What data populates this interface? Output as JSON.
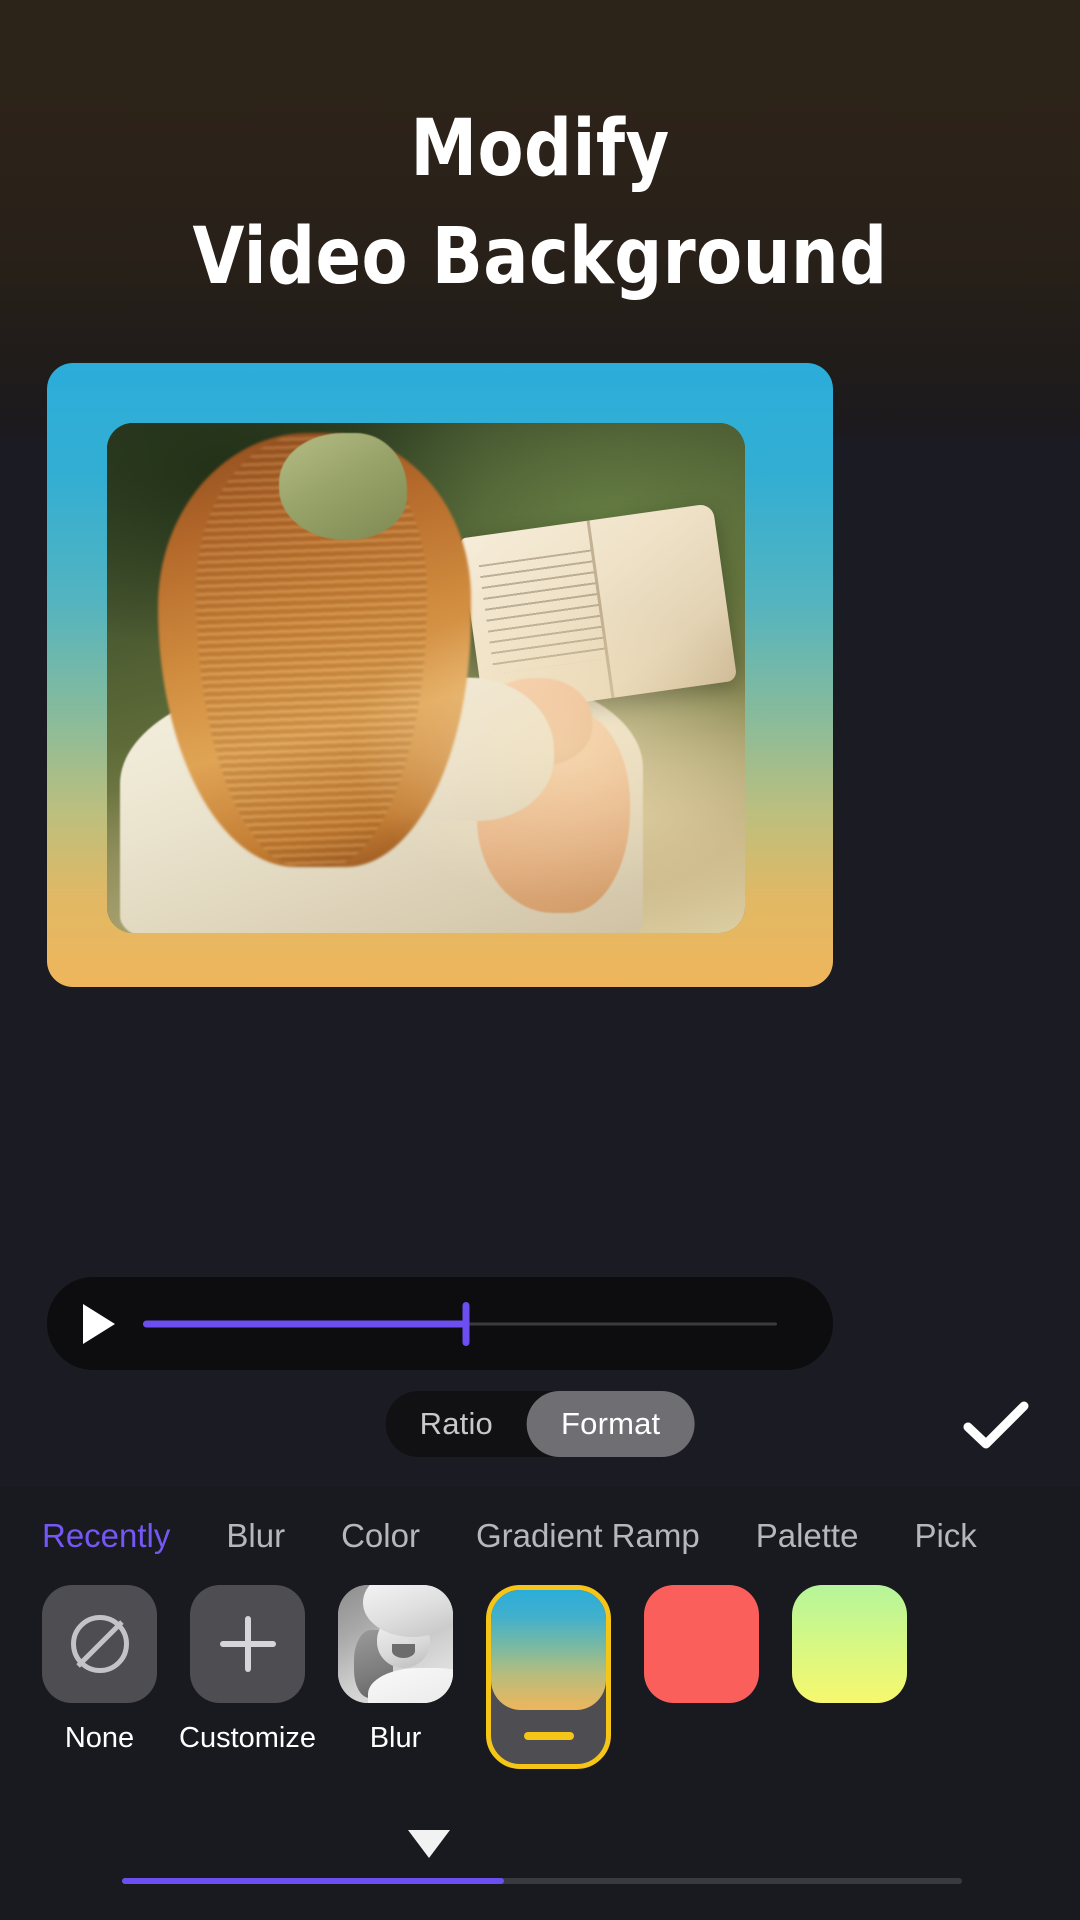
{
  "header": {
    "title_line1": "Modify",
    "title_line2": "Video Background",
    "bg_color_top": "#2d2419",
    "bg_color_bottom": "#1c1a1e"
  },
  "preview": {
    "name": "video-preview-card",
    "background_gradient": [
      "#2badda",
      "#86bb9c",
      "#eeb65c"
    ],
    "video_description": "Woman with long auburn hair and green hair ribbon reading an open book outdoors"
  },
  "playback": {
    "play_icon": "play-icon",
    "progress_percent": 51,
    "track_color": "#6c4ff0",
    "bar_background": "#0d0d10"
  },
  "toggle": {
    "options": [
      {
        "label": "Ratio",
        "selected": false
      },
      {
        "label": "Format",
        "selected": true
      }
    ],
    "confirm_icon": "check-icon",
    "selected_pill_color": "#6e6e73"
  },
  "tabs": {
    "active_color": "#7557f5",
    "items": [
      {
        "label": "Recently",
        "active": true
      },
      {
        "label": "Blur",
        "active": false
      },
      {
        "label": "Color",
        "active": false
      },
      {
        "label": "Gradient Ramp",
        "active": false
      },
      {
        "label": "Palette",
        "active": false
      },
      {
        "label": "Pick",
        "active": false
      }
    ]
  },
  "swatches": {
    "selected_border_color": "#f5c517",
    "items": [
      {
        "label": "None",
        "type": "icon",
        "icon": "prohibition-icon",
        "selected": false
      },
      {
        "label": "Customize",
        "type": "icon",
        "icon": "plus-icon",
        "selected": false
      },
      {
        "label": "Blur",
        "type": "thumbnail",
        "icon": "photo-thumbnail",
        "selected": false
      },
      {
        "label": "",
        "type": "gradient",
        "colors": [
          "#2badda",
          "#76b9a4",
          "#eeb65c"
        ],
        "selected": true
      },
      {
        "label": "",
        "type": "solid",
        "colors": [
          "#fa5f5c"
        ],
        "selected": false
      },
      {
        "label": "",
        "type": "gradient",
        "colors": [
          "#b5f59a",
          "#f7f86e"
        ],
        "selected": false
      }
    ]
  },
  "scrollbar": {
    "fill_percent": 45,
    "fill_color": "#6c4ff0",
    "caret_icon": "caret-down-icon"
  }
}
